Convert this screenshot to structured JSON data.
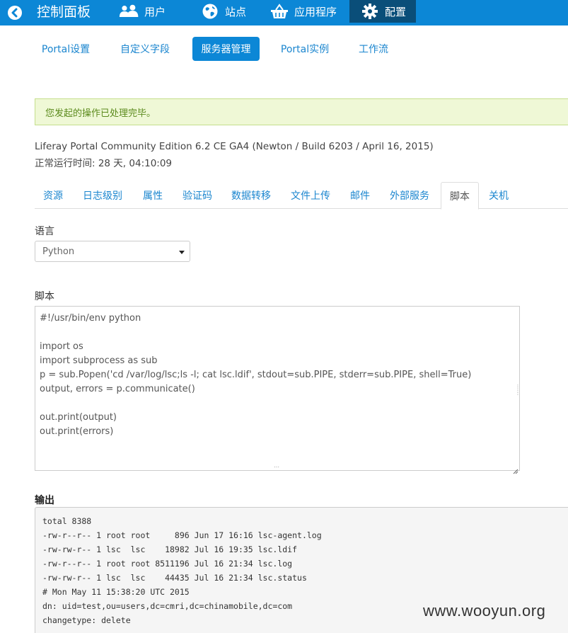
{
  "topbar": {
    "title": "控制面板",
    "nav": [
      {
        "label": "用户",
        "icon": "users-icon"
      },
      {
        "label": "站点",
        "icon": "globe-icon"
      },
      {
        "label": "应用程序",
        "icon": "basket-icon"
      },
      {
        "label": "配置",
        "icon": "gear-icon",
        "active": true
      }
    ]
  },
  "subnav": [
    "Portal设置",
    "自定义字段",
    "服务器管理",
    "Portal实例",
    "工作流"
  ],
  "subnav_active": "服务器管理",
  "alert": "您发起的操作已处理完毕。",
  "server_info": {
    "version": "Liferay Portal Community Edition 6.2 CE GA4 (Newton / Build 6203 / April 16, 2015)",
    "uptime": "正常运行时间: 28 天, 04:10:09"
  },
  "tabs": [
    "资源",
    "日志级别",
    "属性",
    "验证码",
    "数据转移",
    "文件上传",
    "邮件",
    "外部服务",
    "脚本",
    "关机"
  ],
  "tab_active": "脚本",
  "language_label": "语言",
  "language_value": "Python",
  "script_label": "脚本",
  "script_text": "#!/usr/bin/env python\n\nimport os\nimport subprocess as sub\np = sub.Popen('cd /var/log/lsc;ls -l; cat lsc.ldif', stdout=sub.PIPE, stderr=sub.PIPE, shell=True)\noutput, errors = p.communicate()\n\nout.print(output)\nout.print(errors)",
  "output_label": "输出",
  "output_text": "total 8388\n-rw-r--r-- 1 root root     896 Jun 17 16:16 lsc-agent.log\n-rw-rw-r-- 1 lsc  lsc    18982 Jul 16 19:35 lsc.ldif\n-rw-r--r-- 1 root root 8511196 Jul 16 21:34 lsc.log\n-rw-rw-r-- 1 lsc  lsc    44435 Jul 16 21:34 lsc.status\n# Mon May 11 15:38:20 UTC 2015\ndn: uid=test,ou=users,dc=cmri,dc=chinamobile,dc=com\nchangetype: delete",
  "watermark": "www.wooyun.org",
  "colors": {
    "topbar": "#0c87d6",
    "active_nav": "#0a4e79",
    "link": "#1b86cf",
    "alert_bg": "#eff8d6",
    "alert_text": "#5b8a1c"
  }
}
